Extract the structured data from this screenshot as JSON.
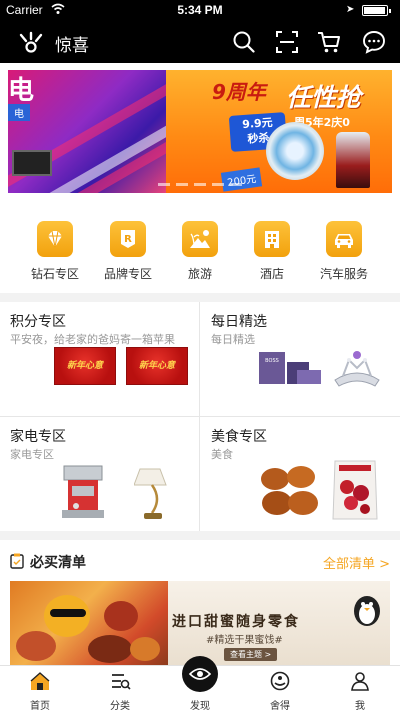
{
  "status_bar": {
    "carrier": "Carrier",
    "time": "5:34 PM"
  },
  "navbar": {
    "title": "惊喜",
    "icons": [
      "search-icon",
      "scan-icon",
      "cart-icon",
      "message-icon"
    ]
  },
  "banner": {
    "left_big_text": "电",
    "left_tag": "电",
    "anniversary": "9周年",
    "headline": "任性抢",
    "subline": "周5年2庆0",
    "sale_line1": "9.9元",
    "sale_line2": "秒杀",
    "price": "200元",
    "slide_count": 5,
    "active_slide": 0
  },
  "categories": [
    {
      "label": "钻石专区",
      "icon": "diamond-icon"
    },
    {
      "label": "品牌专区",
      "icon": "brand-icon"
    },
    {
      "label": "旅游",
      "icon": "travel-icon"
    },
    {
      "label": "酒店",
      "icon": "hotel-icon"
    },
    {
      "label": "汽车服务",
      "icon": "car-icon"
    }
  ],
  "zones": [
    {
      "title": "积分专区",
      "subtitle": "平安夜，给老家的爸妈寄一箱苹果",
      "img_text": "新年心意"
    },
    {
      "title": "每日精选",
      "subtitle": "每日精选",
      "img_text": "BOSS"
    },
    {
      "title": "家电专区",
      "subtitle": "家电专区",
      "img_text": ""
    },
    {
      "title": "美食专区",
      "subtitle": "美食",
      "img_text": ""
    }
  ],
  "must_buy": {
    "title": "必买清单",
    "more_label": "全部清单 >",
    "banner_headline": "进口甜蜜随身零食",
    "banner_sub": "#精选干果蜜饯#",
    "banner_cta": "查看主题 >"
  },
  "tabs": [
    {
      "label": "首页",
      "icon": "home-icon",
      "active": true
    },
    {
      "label": "分类",
      "icon": "category-icon",
      "active": false
    },
    {
      "label": "发现",
      "icon": "discover-icon",
      "active": false
    },
    {
      "label": "舍得",
      "icon": "shede-icon",
      "active": false
    },
    {
      "label": "我",
      "icon": "profile-icon",
      "active": false
    }
  ],
  "colors": {
    "accent": "#f5a623",
    "nav_bg": "#000000",
    "icon_gold": "#f2a10d"
  }
}
